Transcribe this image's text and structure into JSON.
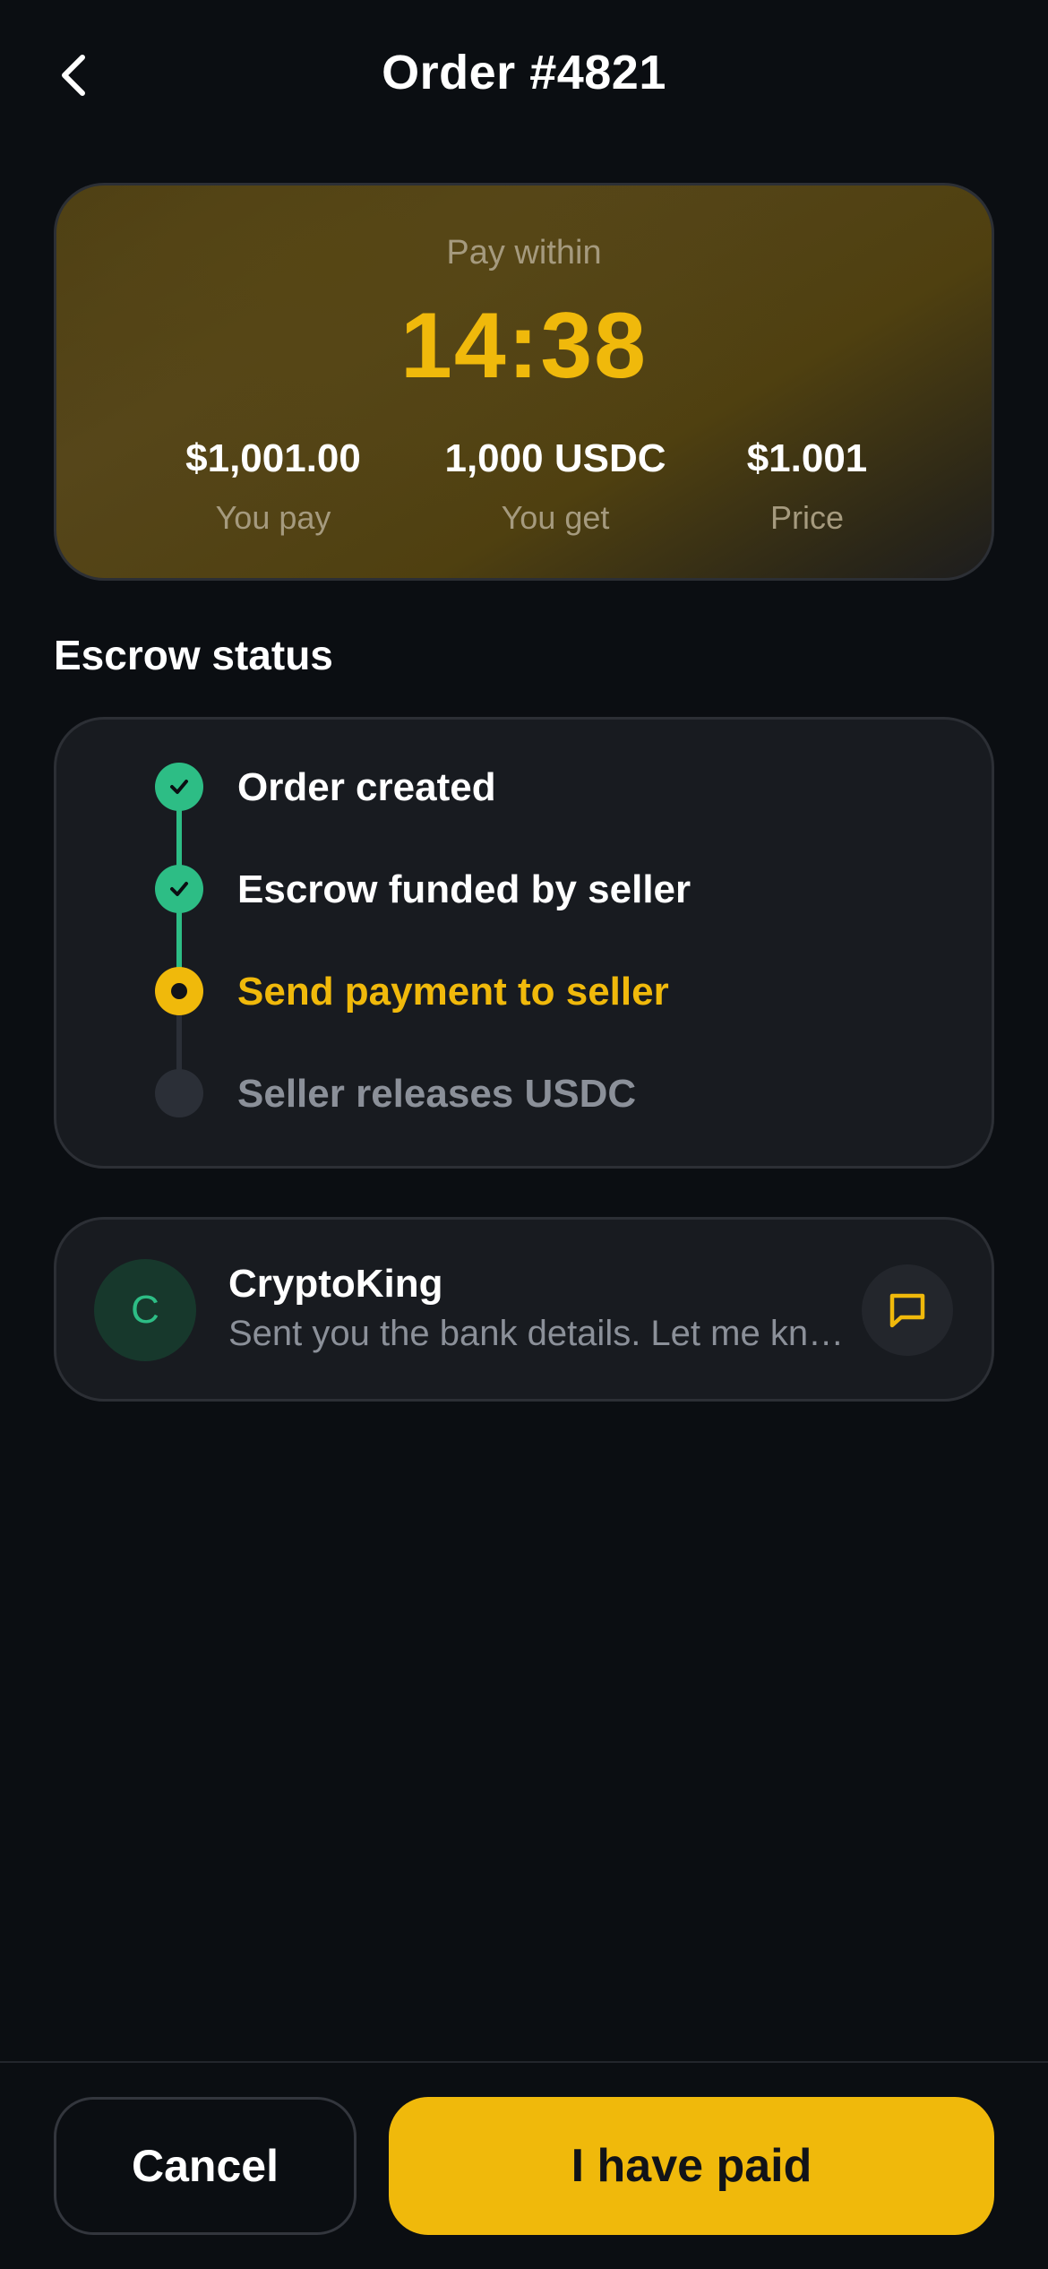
{
  "header": {
    "title": "Order #4821"
  },
  "timer_card": {
    "label": "Pay within",
    "countdown": "14:38",
    "stats": [
      {
        "value": "$1,001.00",
        "label": "You pay"
      },
      {
        "value": "1,000 USDC",
        "label": "You get"
      },
      {
        "value": "$1.001",
        "label": "Price"
      }
    ]
  },
  "escrow": {
    "title": "Escrow status",
    "steps": [
      {
        "label": "Order created",
        "state": "done"
      },
      {
        "label": "Escrow funded by seller",
        "state": "done"
      },
      {
        "label": "Send payment to seller",
        "state": "active"
      },
      {
        "label": "Seller releases USDC",
        "state": "pending"
      }
    ]
  },
  "chat": {
    "avatar_initial": "C",
    "name": "CryptoKing",
    "preview": "Sent you the bank details. Let me know when you have paid."
  },
  "actions": {
    "cancel": "Cancel",
    "paid": "I have paid"
  },
  "colors": {
    "accent": "#f0b90b",
    "success": "#2dbd85",
    "background": "#0b0e12",
    "card": "#181b20"
  },
  "icons": {
    "back": "chevron-left-icon",
    "check": "check-icon",
    "chat": "message-square-icon"
  }
}
